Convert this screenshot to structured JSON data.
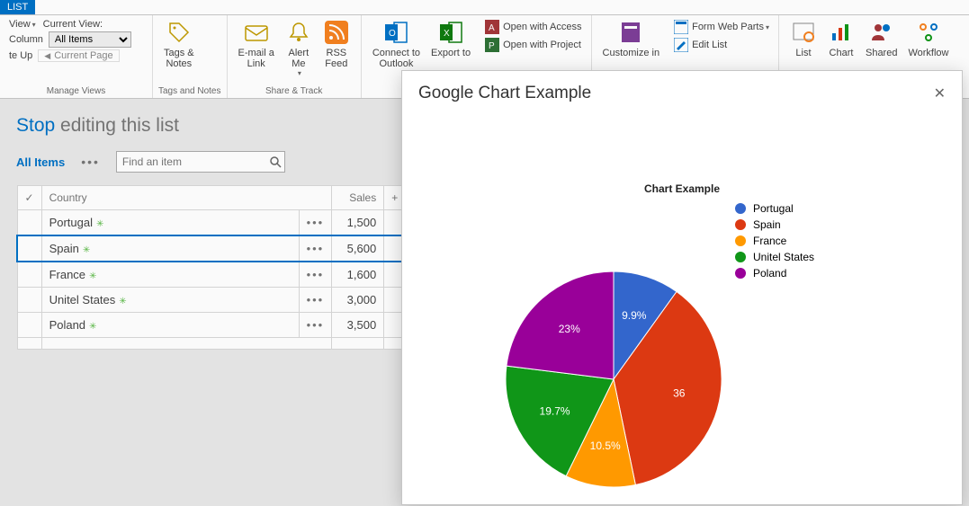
{
  "tab": "LIST",
  "ribbon": {
    "group_view": {
      "label": "Manage Views",
      "view_label": "View",
      "current_view_label": "Current View:",
      "column": "Column",
      "dropdown": "All Items",
      "te_up": "te Up",
      "current_page": "Current Page"
    },
    "group_tags": {
      "label": "Tags and Notes",
      "tags": "Tags &\nNotes"
    },
    "group_share": {
      "label": "Share & Track",
      "email": "E-mail a\nLink",
      "alert": "Alert\nMe",
      "rss": "RSS\nFeed"
    },
    "group_connect": {
      "connect": "Connect to\nOutlook",
      "export": "Export to",
      "access": "Open with Access",
      "project": "Open with Project"
    },
    "group_customize": {
      "customize": "Customize in",
      "form_web": "Form Web Parts",
      "edit_list": "Edit List"
    },
    "group_settings": {
      "list": "List",
      "chart": "Chart",
      "shared": "Shared",
      "workflow": "Workflow"
    }
  },
  "page": {
    "stop": "Stop",
    "editing": "editing this list",
    "all_items": "All Items",
    "search_placeholder": "Find an item"
  },
  "table": {
    "country_header": "Country",
    "sales_header": "Sales",
    "rows": [
      {
        "country": "Portugal",
        "sales": "1,500"
      },
      {
        "country": "Spain",
        "sales": "5,600"
      },
      {
        "country": "France",
        "sales": "1,600"
      },
      {
        "country": "Unitel States",
        "sales": "3,000"
      },
      {
        "country": "Poland",
        "sales": "3,500"
      }
    ]
  },
  "modal": {
    "title": "Google Chart Example"
  },
  "chart_data": {
    "type": "pie",
    "title": "Chart Example",
    "series": [
      {
        "name": "Portugal",
        "value": 1500,
        "pct": 9.9,
        "color": "#3366cc"
      },
      {
        "name": "Spain",
        "value": 5500,
        "pct": 36.8,
        "color": "#dc3912"
      },
      {
        "name": "France",
        "value": 1600,
        "pct": 10.5,
        "color": "#ff9900"
      },
      {
        "name": "Unitel States",
        "value": 3000,
        "pct": 19.7,
        "color": "#109618"
      },
      {
        "name": "Poland",
        "value": 3500,
        "pct": 23.0,
        "color": "#990099"
      }
    ],
    "slice_labels": [
      "9.9%",
      "36",
      "10.5%",
      "19.7%",
      "23%"
    ]
  }
}
